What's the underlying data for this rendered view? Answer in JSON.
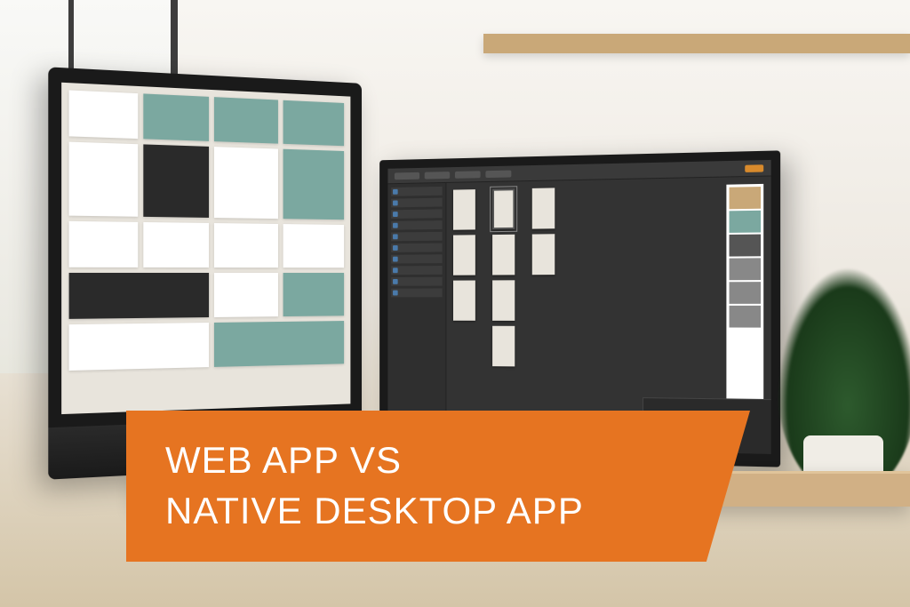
{
  "banner": {
    "line1": "WEB APP VS",
    "line2": "NATIVE DESKTOP APP",
    "bg_color": "#e67421",
    "text_color": "#ffffff"
  }
}
